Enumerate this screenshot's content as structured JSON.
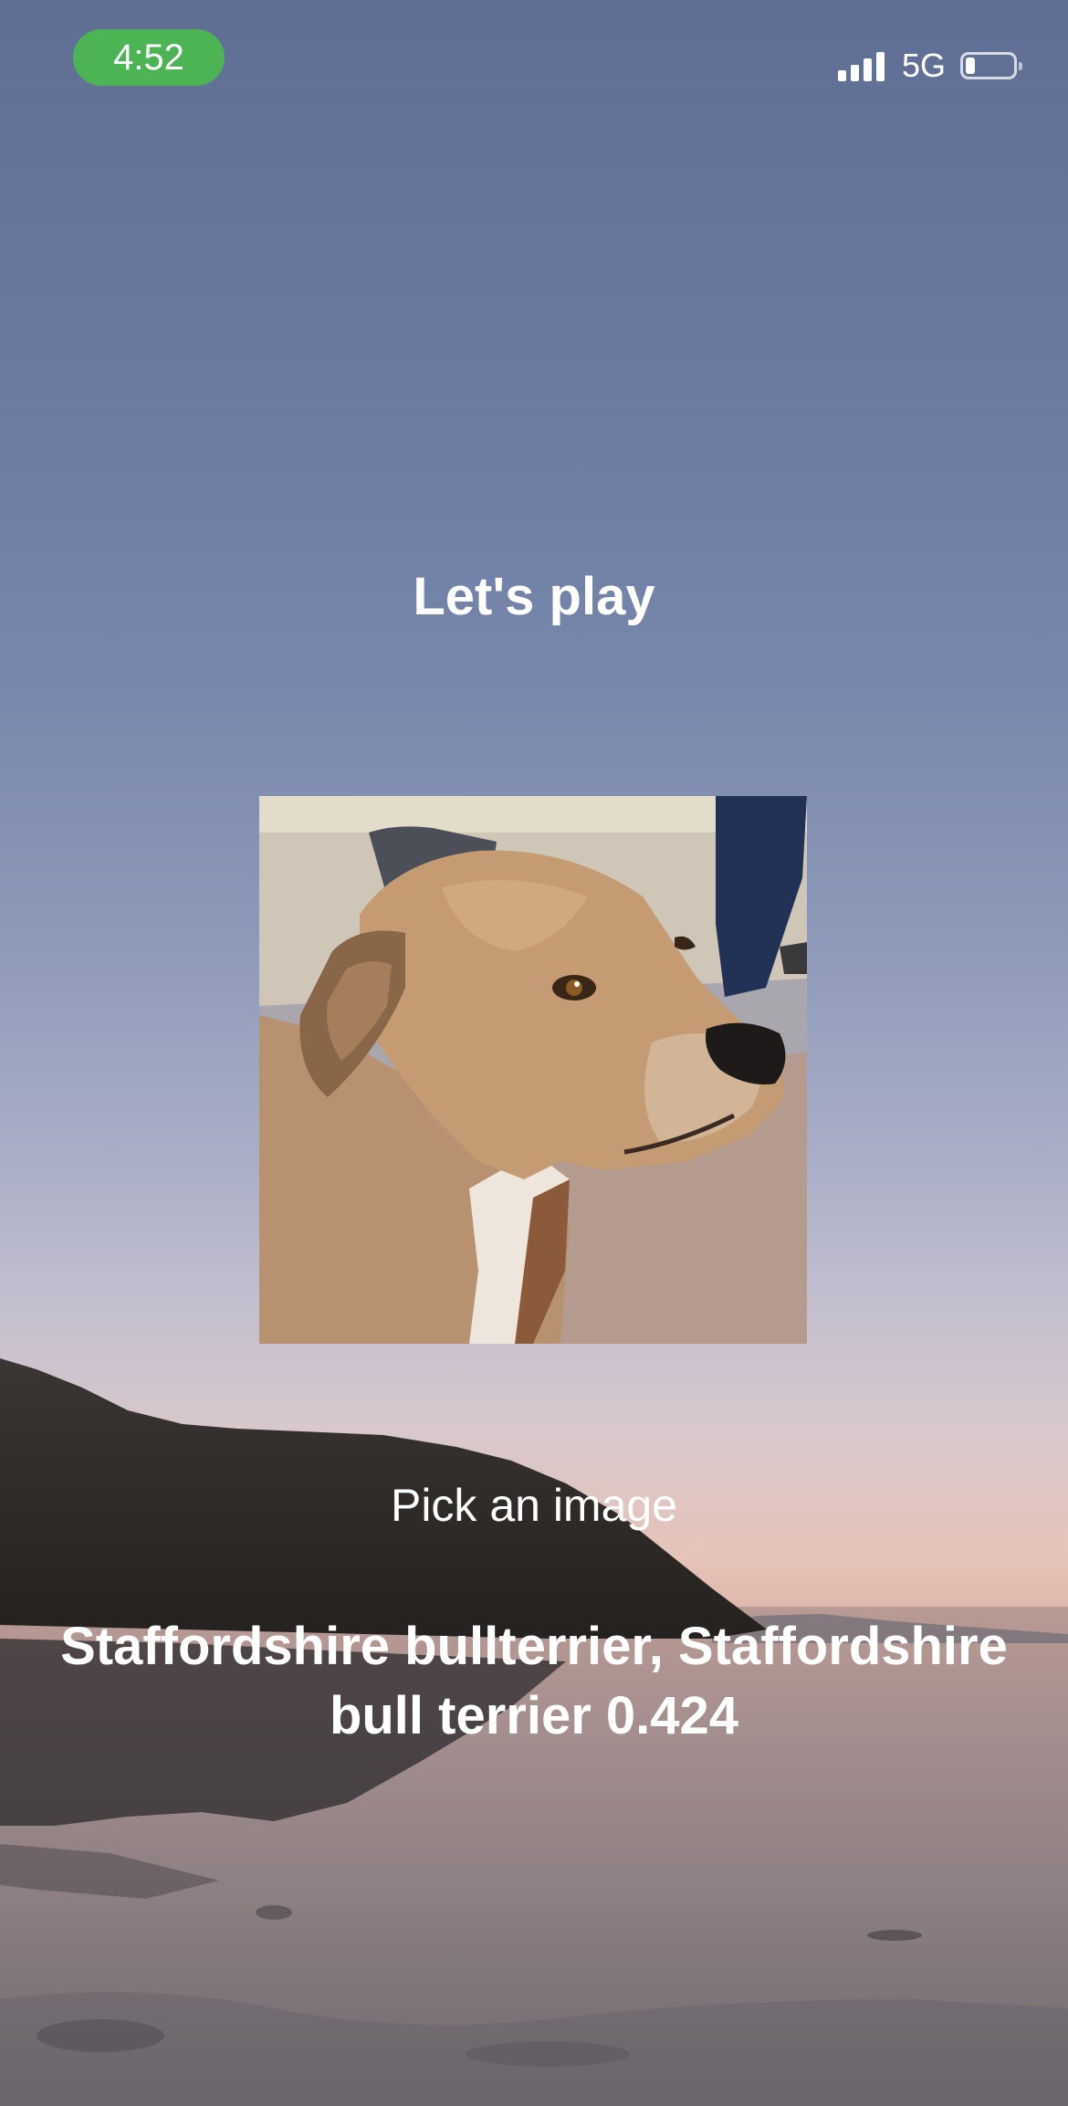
{
  "status_bar": {
    "time": "4:52",
    "network": "5G",
    "battery_level": 0.2,
    "signal_bars": 4,
    "time_pill_color": "#4cb454"
  },
  "main": {
    "title": "Let's play",
    "pick_label": "Pick an image",
    "result_text": "Staffordshire bullterrier, Staffordshire bull terrier 0.424"
  },
  "icons": {
    "signal": "cellular-signal-icon",
    "battery": "battery-icon"
  }
}
